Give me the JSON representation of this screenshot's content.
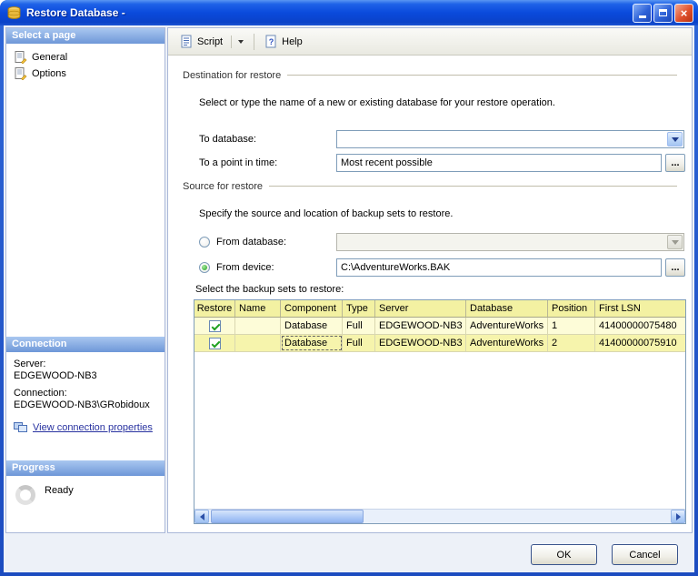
{
  "colors": {
    "titlebar_blue": "#0A4ADC",
    "section_header_blue": "#6E97D8",
    "highlight_yellow": "#F6F4AC",
    "link_blue": "#2832A0"
  },
  "window": {
    "title": "Restore Database -"
  },
  "sidebar": {
    "pages": {
      "header": "Select a page",
      "items": [
        {
          "label": "General"
        },
        {
          "label": "Options"
        }
      ]
    },
    "connection": {
      "header": "Connection",
      "server_label": "Server:",
      "server_value": "EDGEWOOD-NB3",
      "connection_label": "Connection:",
      "connection_value": "EDGEWOOD-NB3\\GRobidoux",
      "link": "View connection properties"
    },
    "progress": {
      "header": "Progress",
      "status": "Ready"
    }
  },
  "toolbar": {
    "script": "Script",
    "help": "Help"
  },
  "main": {
    "destination": {
      "title": "Destination for restore",
      "description": "Select or type the name of a new or existing database for your restore operation.",
      "to_database_label": "To database:",
      "to_database_value": "",
      "point_in_time_label": "To a point in time:",
      "point_in_time_value": "Most recent possible",
      "browse": "..."
    },
    "source": {
      "title": "Source for restore",
      "description": "Specify the source and location of backup sets to restore.",
      "from_database_label": "From database:",
      "from_database_value": "",
      "from_device_label": "From device:",
      "from_device_value": "C:\\AdventureWorks.BAK",
      "browse": "...",
      "backup_sets_label": "Select the backup sets to restore:"
    },
    "table": {
      "columns": [
        "Restore",
        "Name",
        "Component",
        "Type",
        "Server",
        "Database",
        "Position",
        "First LSN"
      ],
      "rows": [
        {
          "checked": true,
          "name": "",
          "component": "Database",
          "type": "Full",
          "server": "EDGEWOOD-NB3",
          "database": "AdventureWorks",
          "position": "1",
          "first_lsn": "41400000075480"
        },
        {
          "checked": true,
          "name": "",
          "component": "Database",
          "type": "Full",
          "server": "EDGEWOOD-NB3",
          "database": "AdventureWorks",
          "position": "2",
          "first_lsn": "41400000075910"
        }
      ]
    }
  },
  "footer": {
    "ok": "OK",
    "cancel": "Cancel"
  }
}
